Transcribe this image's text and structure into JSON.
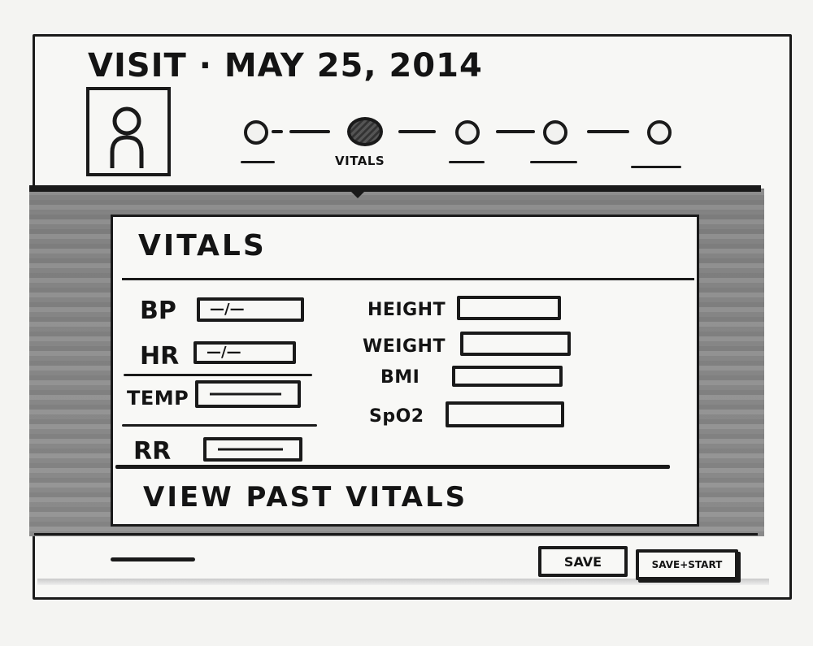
{
  "header": {
    "title": "VISIT · MAY 25, 2014"
  },
  "stepper": {
    "steps": [
      {
        "label": "",
        "active": false
      },
      {
        "label": "VITALS",
        "active": true
      },
      {
        "label": "",
        "active": false
      },
      {
        "label": "",
        "active": false
      },
      {
        "label": "",
        "active": false
      }
    ],
    "active_label": "VITALS"
  },
  "vitals_card": {
    "title": "VITALS",
    "left_fields": [
      {
        "label": "BP",
        "hint": "—/—"
      },
      {
        "label": "HR",
        "hint": "—/—"
      },
      {
        "label": "TEMP",
        "hint": ""
      },
      {
        "label": "RR",
        "hint": ""
      }
    ],
    "right_fields": [
      {
        "label": "HEIGHT"
      },
      {
        "label": "WEIGHT"
      },
      {
        "label": "BMI"
      },
      {
        "label": "SpO2"
      }
    ],
    "view_past_link": "VIEW PAST VITALS"
  },
  "footer": {
    "save_label": "SAVE",
    "save_start_label": "SAVE+START"
  }
}
